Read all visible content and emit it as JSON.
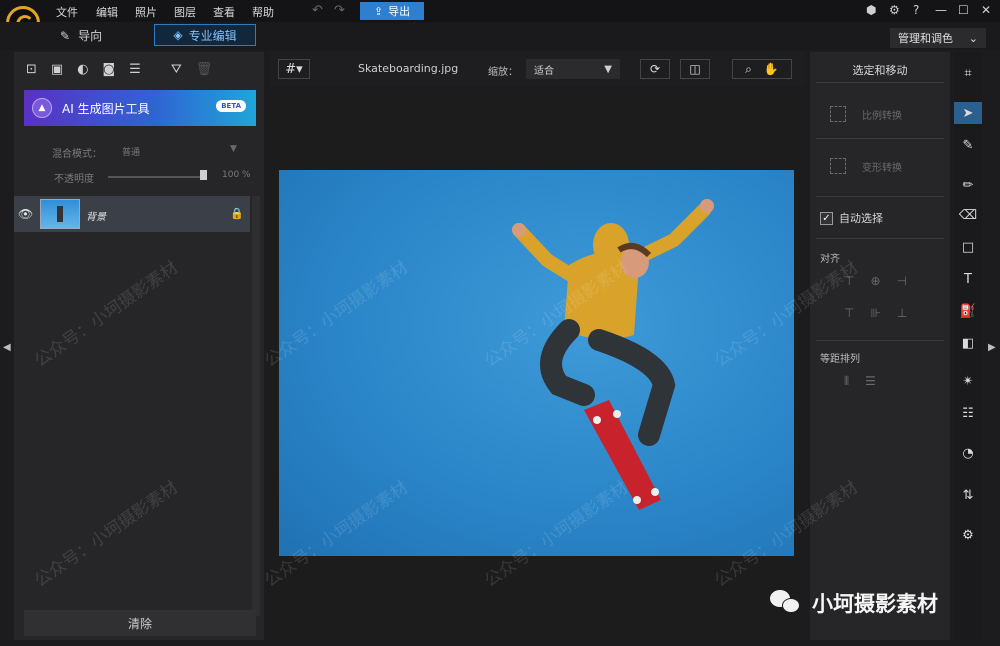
{
  "menu": {
    "items": [
      "文件",
      "编辑",
      "照片",
      "图层",
      "查看",
      "帮助"
    ],
    "export_label": "导出",
    "help_icon": "?"
  },
  "modes": {
    "guide_label": "导向",
    "pro_label": "专业编辑",
    "manage_label": "管理和调色"
  },
  "left_panel": {
    "ai_button_label": "AI 生成图片工具",
    "beta_label": "BETA",
    "blend_mode_label": "混合模式：",
    "blend_mode_value": "普通",
    "opacity_label": "不透明度",
    "opacity_value": "100 %",
    "layer_name": "背景",
    "clear_label": "清除"
  },
  "canvas": {
    "filename": "Skateboarding.jpg",
    "zoom_label": "缩放：",
    "zoom_value": "适合"
  },
  "right_panel": {
    "title": "选定和移动",
    "scale_transform": "比例转换",
    "warp_transform": "变形转换",
    "auto_select_label": "自动选择",
    "align_label": "对齐",
    "distribute_label": "等距排列"
  },
  "watermark": {
    "text": "公众号：小坷摄影素材",
    "brand": "小坷摄影素材"
  },
  "colors": {
    "accent": "#2f7fd0",
    "logo": "#e3a520",
    "sky": "#2b86c9"
  }
}
